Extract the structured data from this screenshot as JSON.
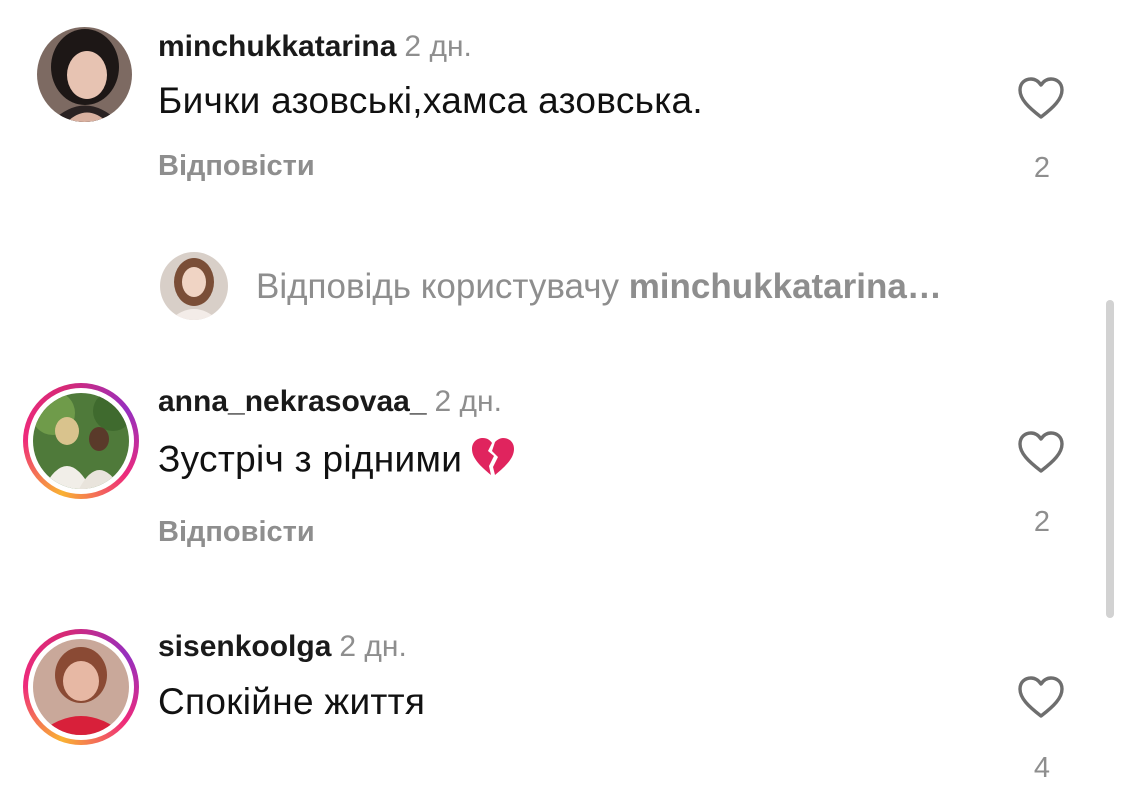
{
  "comments": [
    {
      "username": "minchukkatarina",
      "time": "2 дн.",
      "text": "Бички азовські,хамса азовська.",
      "reply_label": "Відповісти",
      "likes": "2",
      "avatar_icon": "user-avatar",
      "story_ring": false
    },
    {
      "username": "anna_nekrasovaa_",
      "time": "2 дн.",
      "text": "Зустріч з рідними",
      "emoji": "broken-heart-icon",
      "reply_label": "Відповісти",
      "likes": "2",
      "avatar_icon": "user-avatar",
      "story_ring": true
    },
    {
      "username": "sisenkoolga",
      "time": "2 дн.",
      "text": "Спокійне життя",
      "likes": "4",
      "avatar_icon": "user-avatar",
      "story_ring": true
    }
  ],
  "reply_input": {
    "prefix": "Відповідь користувачу ",
    "target": "minchukkatarina…"
  },
  "colors": {
    "muted": "#8e8e8e",
    "text": "#111111",
    "story_ring_start": "#f9b233",
    "story_ring_end": "#ee2a7b",
    "broken_heart": "#e0245e"
  }
}
